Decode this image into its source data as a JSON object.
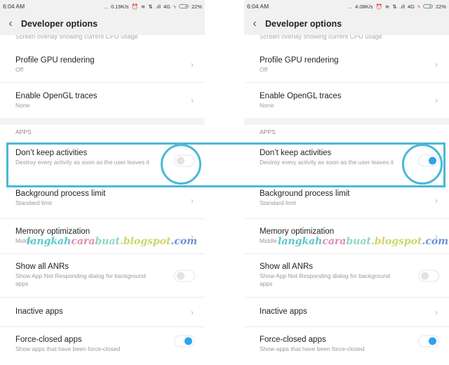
{
  "panels": [
    {
      "status": {
        "time": "6:04 AM",
        "dots": "...",
        "speed": "0.19K/s",
        "alarm": "⏰",
        "wifi": "wifi-icon",
        "data": "⇅",
        "signal": ".ıll",
        "network": "4G",
        "charge": "ϟ",
        "battery": "22%"
      },
      "header": {
        "back": "‹",
        "title": "Developer options"
      },
      "partial": "Screen overlay showing current CPU usage",
      "items_top": [
        {
          "title": "Profile GPU rendering",
          "subtitle": "Off"
        },
        {
          "title": "Enable OpenGL traces",
          "subtitle": "None"
        }
      ],
      "section": "APPS",
      "dont_keep": {
        "title": "Don’t keep activities",
        "subtitle": "Destroy every activity as soon as the user leaves it",
        "enabled": false
      },
      "items_bottom": [
        {
          "title": "Background process limit",
          "subtitle": "Standard limit"
        },
        {
          "title": "Memory optimization",
          "subtitle": "Middle"
        }
      ],
      "anrs": {
        "title": "Show all ANRs",
        "subtitle": "Show App Not Responding dialog for background apps",
        "enabled": false
      },
      "inactive": {
        "title": "Inactive apps"
      },
      "force": {
        "title": "Force-closed apps",
        "subtitle": "Show apps that have been force-closed",
        "enabled": true
      }
    },
    {
      "status": {
        "time": "6:04 AM",
        "dots": "...",
        "speed": "4.08K/s",
        "alarm": "⏰",
        "wifi": "wifi-icon",
        "data": "⇅",
        "signal": ".ıll",
        "network": "4G",
        "charge": "ϟ",
        "battery": "22%"
      },
      "header": {
        "back": "‹",
        "title": "Developer options"
      },
      "partial": "Screen overlay showing current CPU usage",
      "items_top": [
        {
          "title": "Profile GPU rendering",
          "subtitle": "Off"
        },
        {
          "title": "Enable OpenGL traces",
          "subtitle": "None"
        }
      ],
      "section": "APPS",
      "dont_keep": {
        "title": "Don’t keep activities",
        "subtitle": "Destroy every activity as soon as the user leaves it",
        "enabled": true
      },
      "items_bottom": [
        {
          "title": "Background process limit",
          "subtitle": "Standard limit"
        },
        {
          "title": "Memory optimization",
          "subtitle": "Middle"
        }
      ],
      "anrs": {
        "title": "Show all ANRs",
        "subtitle": "Show App Not Responding dialog for background apps",
        "enabled": false
      },
      "inactive": {
        "title": "Inactive apps"
      },
      "force": {
        "title": "Force-closed apps",
        "subtitle": "Show apps that have been force-closed",
        "enabled": true
      }
    }
  ],
  "watermark": {
    "a": "langkah",
    "b": "cara",
    "c": "buat",
    "d": ".blogspot",
    "e": ".com"
  },
  "colors": {
    "highlight": "#4ab8d6",
    "toggle_on": "#2fa3f0",
    "toggle_off": "#e3e3e3"
  }
}
